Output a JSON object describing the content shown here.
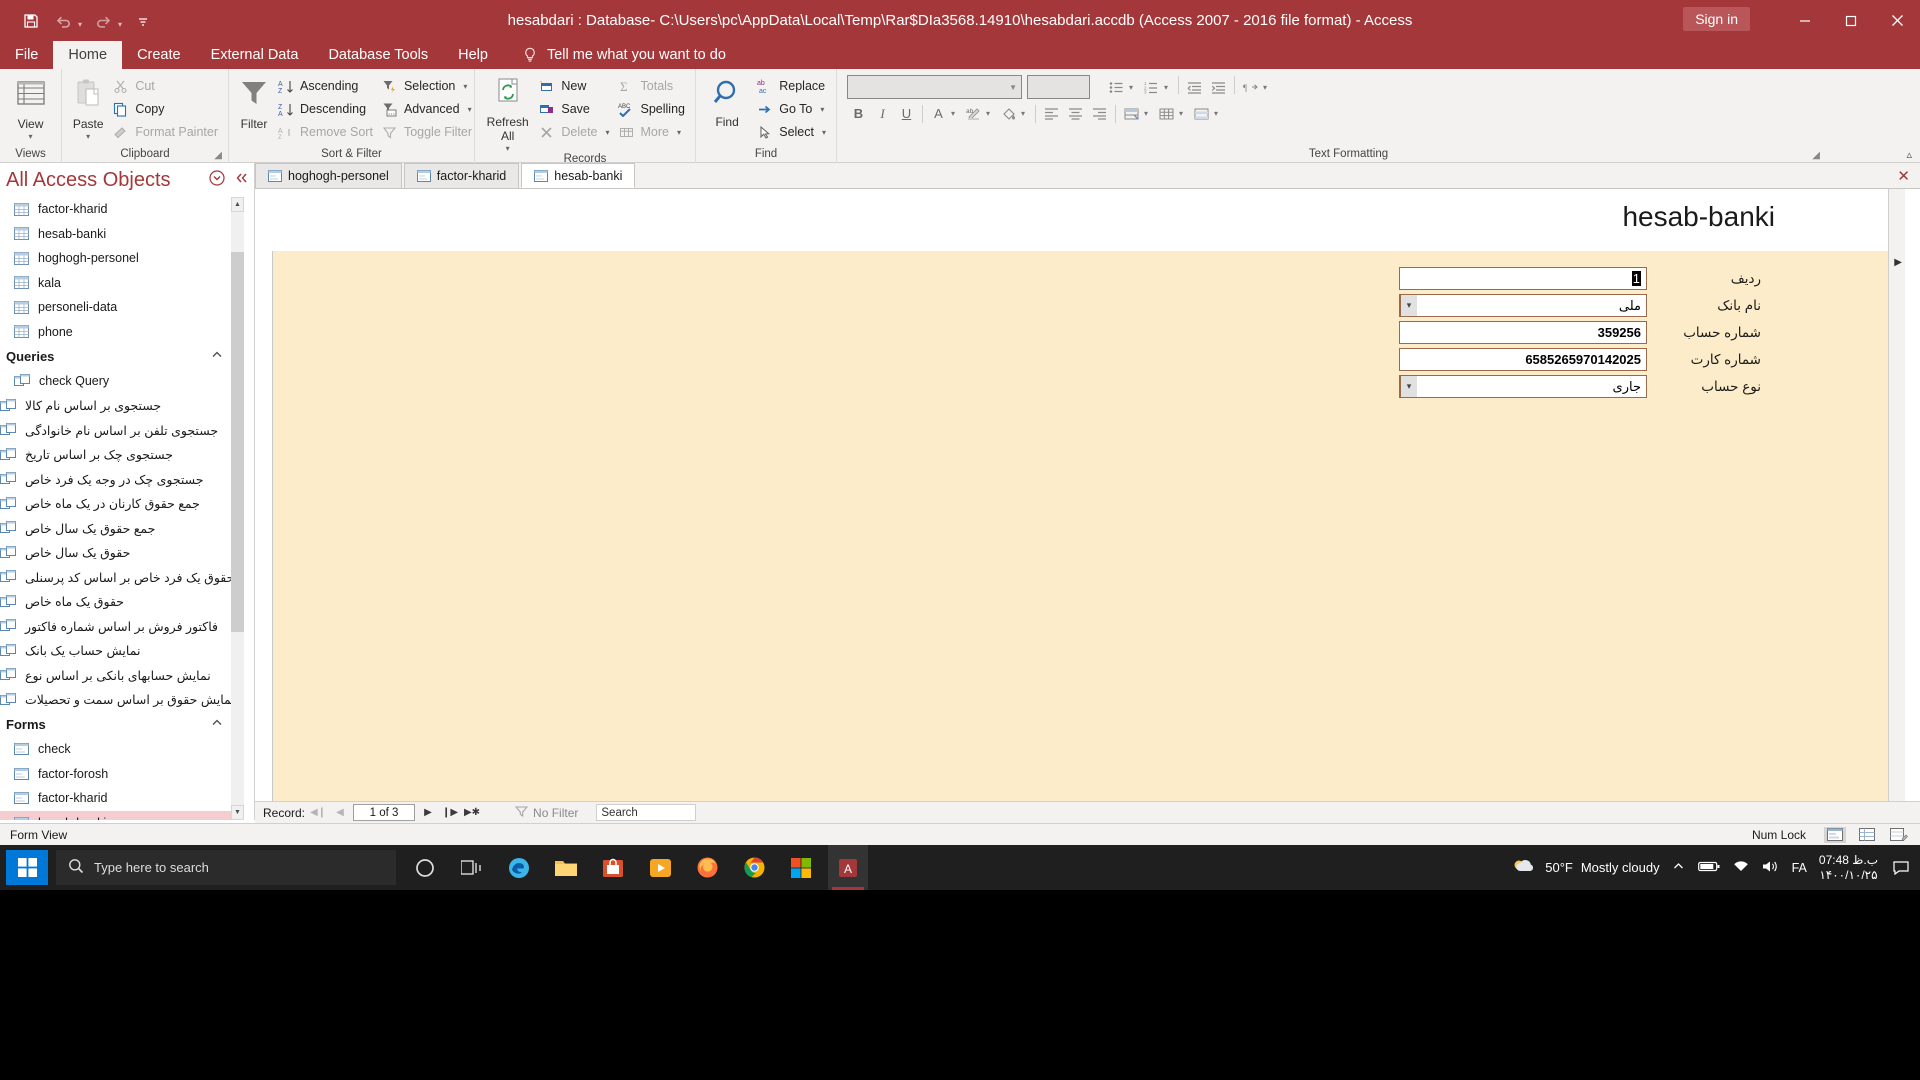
{
  "titlebar": {
    "title": "hesabdari : Database- C:\\Users\\pc\\AppData\\Local\\Temp\\Rar$DIa3568.14910\\hesabdari.accdb (Access 2007 - 2016 file format)  -  Access",
    "sign_in": "Sign in",
    "qat": [
      {
        "name": "save-icon",
        "label": "Save"
      },
      {
        "name": "undo-icon",
        "label": "Undo"
      },
      {
        "name": "redo-icon",
        "label": "Redo"
      },
      {
        "name": "customize-qat-icon",
        "label": "Customize Quick Access Toolbar"
      }
    ],
    "window_controls": [
      {
        "name": "minimize-button",
        "glyph": "─"
      },
      {
        "name": "maximize-button",
        "glyph": "☐"
      },
      {
        "name": "close-button",
        "glyph": "✕"
      }
    ]
  },
  "ribbon": {
    "tabs": [
      {
        "label": "File",
        "active": false
      },
      {
        "label": "Home",
        "active": true
      },
      {
        "label": "Create",
        "active": false
      },
      {
        "label": "External Data",
        "active": false
      },
      {
        "label": "Database Tools",
        "active": false
      },
      {
        "label": "Help",
        "active": false
      }
    ],
    "tell_me": "Tell me what you want to do",
    "groups": [
      {
        "name": "views",
        "label": "Views",
        "big_buttons": [
          {
            "label": "View",
            "icon": "datasheet-view-icon",
            "has_dropdown": true
          }
        ],
        "small_buttons": []
      },
      {
        "name": "clipboard",
        "label": "Clipboard",
        "has_launcher": true,
        "big_buttons": [
          {
            "label": "Paste",
            "icon": "paste-icon",
            "has_dropdown": true
          }
        ],
        "small_buttons": [
          {
            "label": "Cut",
            "icon": "scissors-icon",
            "disabled": true
          },
          {
            "label": "Copy",
            "icon": "copy-icon",
            "disabled": false
          },
          {
            "label": "Format Painter",
            "icon": "format-painter-icon",
            "disabled": true
          }
        ]
      },
      {
        "name": "sort-filter",
        "label": "Sort & Filter",
        "big_buttons": [
          {
            "label": "Filter",
            "icon": "funnel-icon",
            "has_dropdown": false
          }
        ],
        "small_buttons": [
          {
            "label": "Ascending",
            "icon": "sort-ascending-icon",
            "disabled": false
          },
          {
            "label": "Descending",
            "icon": "sort-descending-icon",
            "disabled": false
          },
          {
            "label": "Remove Sort",
            "icon": "remove-sort-icon",
            "disabled": true
          }
        ],
        "small_buttons2": [
          {
            "label": "Selection",
            "icon": "selection-filter-icon",
            "disabled": false,
            "chev": true
          },
          {
            "label": "Advanced",
            "icon": "advanced-filter-icon",
            "disabled": false,
            "chev": true
          },
          {
            "label": "Toggle Filter",
            "icon": "toggle-filter-icon",
            "disabled": true
          }
        ]
      },
      {
        "name": "records",
        "label": "Records",
        "big_buttons": [
          {
            "label": "Refresh All",
            "icon": "refresh-icon",
            "has_dropdown": true
          }
        ],
        "small_buttons": [
          {
            "label": "New",
            "icon": "new-record-icon",
            "disabled": false
          },
          {
            "label": "Save",
            "icon": "save-record-icon",
            "disabled": false
          },
          {
            "label": "Delete",
            "icon": "delete-record-icon",
            "disabled": true,
            "chev": true
          }
        ],
        "small_buttons2": [
          {
            "label": "Totals",
            "icon": "totals-icon",
            "disabled": true
          },
          {
            "label": "Spelling",
            "icon": "spelling-icon",
            "disabled": false
          },
          {
            "label": "More",
            "icon": "more-icon",
            "disabled": true,
            "chev": true
          }
        ]
      },
      {
        "name": "find",
        "label": "Find",
        "big_buttons": [
          {
            "label": "Find",
            "icon": "magnifier-icon",
            "has_dropdown": false
          }
        ],
        "small_buttons": [
          {
            "label": "Replace",
            "icon": "replace-icon",
            "disabled": false
          },
          {
            "label": "Go To",
            "icon": "go-to-icon",
            "disabled": false,
            "chev": true
          },
          {
            "label": "Select",
            "icon": "select-icon",
            "disabled": false,
            "chev": true
          }
        ]
      },
      {
        "name": "text-formatting",
        "label": "Text Formatting",
        "has_launcher": true,
        "font_name": "",
        "font_size": "",
        "buttons": [
          {
            "name": "bold-button",
            "glyph": "B"
          },
          {
            "name": "italic-button",
            "glyph": "I"
          },
          {
            "name": "underline-button",
            "glyph": "U"
          },
          {
            "name": "font-color-button",
            "glyph": "A"
          },
          {
            "name": "text-highlight-button",
            "glyph": "ab"
          },
          {
            "name": "background-color-button",
            "glyph": "fill"
          },
          {
            "name": "bullets-button",
            "glyph": "list"
          },
          {
            "name": "numbering-button",
            "glyph": "numlist"
          },
          {
            "name": "decrease-indent-button",
            "glyph": "outdent"
          },
          {
            "name": "increase-indent-button",
            "glyph": "indent"
          },
          {
            "name": "text-direction-button",
            "glyph": "rtl"
          },
          {
            "name": "align-left-button",
            "glyph": "alignleft"
          },
          {
            "name": "align-center-button",
            "glyph": "aligncenter"
          },
          {
            "name": "align-right-button",
            "glyph": "alignright"
          },
          {
            "name": "conditional-formatting-button",
            "glyph": "cf"
          },
          {
            "name": "gridlines-button",
            "glyph": "grid"
          }
        ]
      }
    ]
  },
  "navpane": {
    "title": "All Access Objects",
    "tables": [
      {
        "label": "factor-kharid",
        "rtl": false
      },
      {
        "label": "hesab-banki",
        "rtl": false
      },
      {
        "label": "hoghogh-personel",
        "rtl": false
      },
      {
        "label": "kala",
        "rtl": false
      },
      {
        "label": "personeli-data",
        "rtl": false
      },
      {
        "label": "phone",
        "rtl": false
      }
    ],
    "queries_header": "Queries",
    "queries": [
      {
        "label": "check Query",
        "rtl": false
      },
      {
        "label": "جستجوی بر اساس نام کالا",
        "rtl": true
      },
      {
        "label": "جستجوی تلفن بر اساس نام خانوادگی",
        "rtl": true
      },
      {
        "label": "جستجوی چک بر اساس تاریخ",
        "rtl": true
      },
      {
        "label": "جستجوی چک در وجه یک فرد خاص",
        "rtl": true
      },
      {
        "label": "جمع حقوق کارنان در یک ماه خاص",
        "rtl": true
      },
      {
        "label": "جمع حقوق یک سال خاص",
        "rtl": true
      },
      {
        "label": "حقوق یک سال خاص",
        "rtl": true
      },
      {
        "label": "حقوق یک فرد خاص بر اساس کد پرسنلی",
        "rtl": true
      },
      {
        "label": "حقوق یک ماه خاص",
        "rtl": true
      },
      {
        "label": "فاکتور فروش بر اساس شماره فاکتور",
        "rtl": true
      },
      {
        "label": "نمایش حساب یک بانک",
        "rtl": true
      },
      {
        "label": "نمایش حسابهای بانکی بر اساس نوع",
        "rtl": true
      },
      {
        "label": "نمایش حقوق بر اساس سمت و تحصیلات",
        "rtl": true
      }
    ],
    "forms_header": "Forms",
    "forms": [
      {
        "label": "check",
        "rtl": false,
        "selected": false
      },
      {
        "label": "factor-forosh",
        "rtl": false,
        "selected": false
      },
      {
        "label": "factor-kharid",
        "rtl": false,
        "selected": false
      },
      {
        "label": "hesab-banki",
        "rtl": false,
        "selected": true
      }
    ]
  },
  "doctabs": {
    "tabs": [
      {
        "label": "hoghogh-personel",
        "active": false
      },
      {
        "label": "factor-kharid",
        "active": false
      },
      {
        "label": "hesab-banki",
        "active": true
      }
    ],
    "close_label": "✕"
  },
  "form": {
    "title": "hesab-banki",
    "fields": [
      {
        "label": "ردیف",
        "value": "1",
        "type": "text",
        "selected": true
      },
      {
        "label": "نام بانک",
        "value": "ملی",
        "type": "combo",
        "selected": false
      },
      {
        "label": "شماره حساب",
        "value": "359256",
        "type": "text",
        "selected": false
      },
      {
        "label": "شماره کارت",
        "value": "6585265970142025",
        "type": "text",
        "selected": false
      },
      {
        "label": "نوع حساب",
        "value": "جاری",
        "type": "combo",
        "selected": false
      }
    ]
  },
  "recordbar": {
    "label": "Record:",
    "position": "1 of 3",
    "first": "◀❙",
    "prev": "◀",
    "next": "▶",
    "last": "❙▶",
    "new": "▶✱",
    "filter_status": "No Filter",
    "search_placeholder": "Search"
  },
  "statusbar": {
    "view_mode": "Form View",
    "num_lock": "Num Lock",
    "views": [
      {
        "name": "form-view-button",
        "active": true
      },
      {
        "name": "layout-view-button",
        "active": false
      },
      {
        "name": "design-view-button",
        "active": false
      }
    ]
  },
  "taskbar": {
    "search_placeholder": "Type here to search",
    "apps": [
      {
        "name": "cortana-icon",
        "active": false
      },
      {
        "name": "task-view-icon",
        "active": false
      },
      {
        "name": "edge-icon",
        "active": false
      },
      {
        "name": "file-explorer-icon",
        "active": false
      },
      {
        "name": "microsoft-store-icon",
        "active": false
      },
      {
        "name": "media-player-icon",
        "active": false
      },
      {
        "name": "firefox-icon",
        "active": false
      },
      {
        "name": "chrome-icon",
        "active": false
      },
      {
        "name": "office-icon",
        "active": false
      },
      {
        "name": "access-icon",
        "active": true
      }
    ],
    "weather_temp": "50°F",
    "weather_desc": "Mostly cloudy",
    "clock_time": "07:48 ب.ظ",
    "clock_date": "۱۴۰۰/۱۰/۲۵",
    "language": "FA"
  },
  "colors": {
    "accent": "#a4373a",
    "form_bg": "#fcecc9",
    "ribbon_bg": "#f3f2f1",
    "field_border": "#9b6a4a",
    "selected_nav": "#f5cdd0"
  }
}
